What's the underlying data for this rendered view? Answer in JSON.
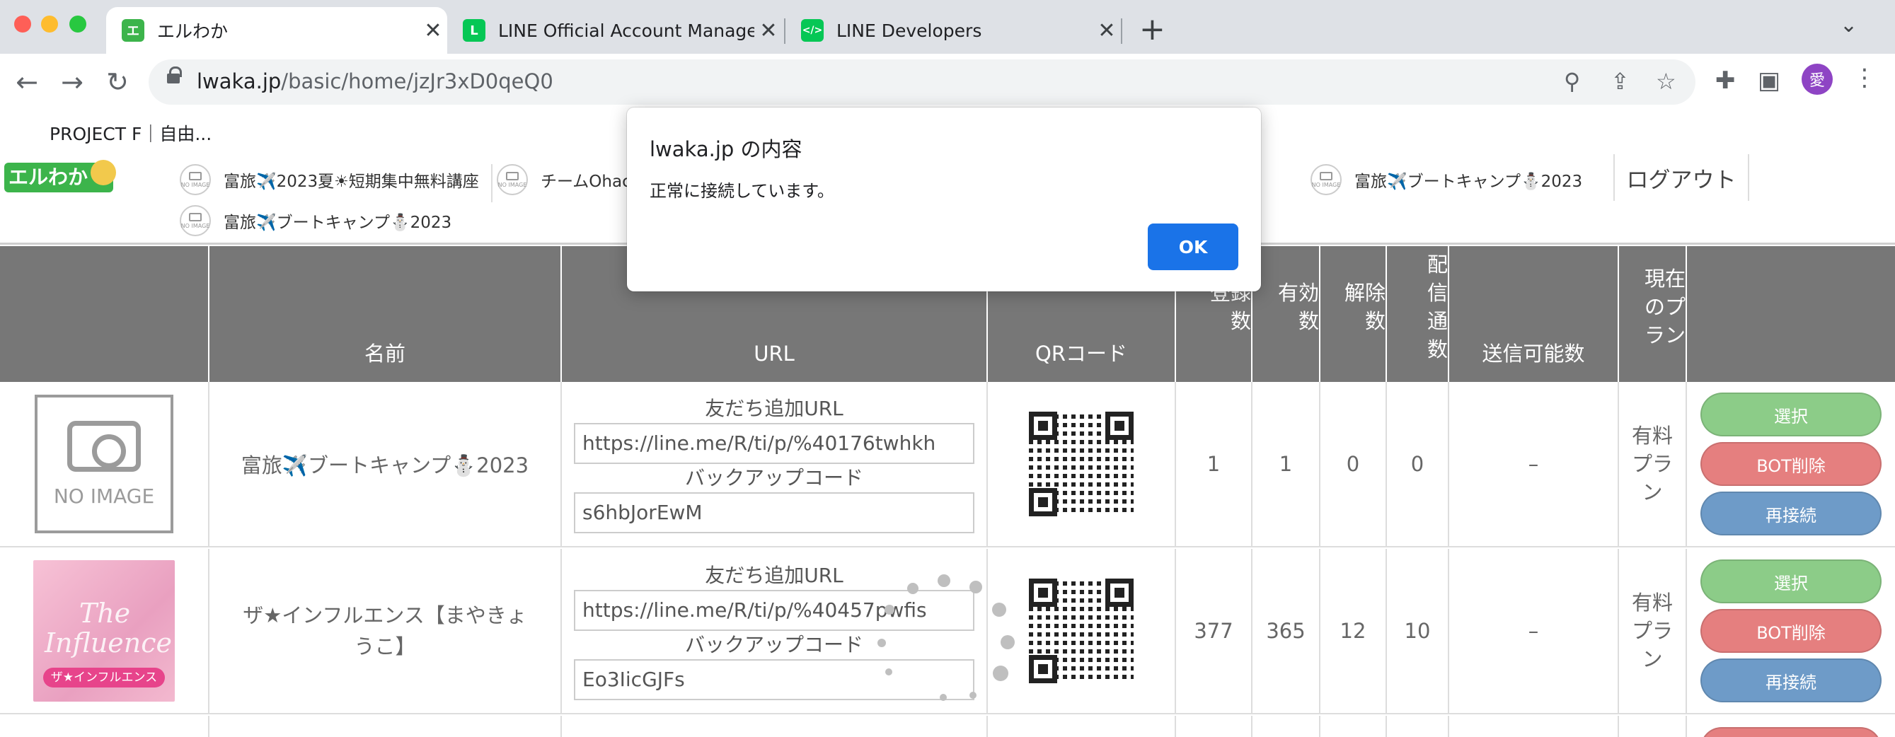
{
  "browser": {
    "tabs": [
      {
        "title": "エルわか",
        "active": true
      },
      {
        "title": "LINE Official Account Manager"
      },
      {
        "title": "LINE Developers"
      }
    ],
    "url_host": "lwaka.jp",
    "url_path": "/basic/home/jzJr3xD0qeQ0",
    "bookmark": "PROJECT F｜自由...",
    "avatar_char": "愛"
  },
  "header": {
    "logo": "エルわか",
    "no_image": "NO IMAGE",
    "accounts": [
      "富旅✈️2023夏☀短期集中無料講座",
      "チームOhaco",
      "富旅✈️ブートキャンプ⛄2023",
      "富旅✈️ブートキャンプ⛄2023"
    ],
    "logout": "ログアウト"
  },
  "table": {
    "headers": {
      "name": "名前",
      "url": "URL",
      "qr": "QRコード",
      "registered": [
        "登録",
        "数"
      ],
      "active": [
        "有効",
        "数"
      ],
      "cancelled": [
        "解除",
        "数"
      ],
      "delivered": [
        "配",
        "信",
        "通",
        "数"
      ],
      "sendable": "送信可能数",
      "plan": [
        "現在",
        "のプ",
        "ラン"
      ]
    },
    "labels": {
      "friend_url": "友だち追加URL",
      "backup_code": "バックアップコード",
      "no_image": "NO IMAGE",
      "influence_text": "The Influence",
      "influence_caption": "ザ★インフルエンス"
    },
    "buttons": {
      "select": "選択",
      "delete_bot": "BOT削除",
      "reconnect": "再接続"
    },
    "rows": [
      {
        "name": "富旅✈️ブートキャンプ⛄2023",
        "friend_url": "https://line.me/R/ti/p/%40176twhkh",
        "backup_code": "s6hbJorEwM",
        "registered": "1",
        "active": "1",
        "cancelled": "0",
        "delivered": "0",
        "sendable": "–",
        "plan": [
          "有料",
          "プラ",
          "ン"
        ]
      },
      {
        "name": "ザ★インフルエンス【まやきょうこ】",
        "friend_url": "https://line.me/R/ti/p/%40457pwfis",
        "backup_code": "Eo3IicGJFs",
        "registered": "377",
        "active": "365",
        "cancelled": "12",
        "delivered": "10",
        "sendable": "–",
        "plan": [
          "有料",
          "プラ",
          "ン"
        ]
      }
    ]
  },
  "dialog": {
    "title": "lwaka.jp の内容",
    "message": "正常に接続しています。",
    "ok": "OK"
  },
  "colors": {
    "header_bg": "#777777",
    "select_btn": "#8ccc88",
    "delete_btn": "#e57f7f",
    "reconnect_btn": "#6e9bc8",
    "dialog_ok": "#1a73e8"
  }
}
